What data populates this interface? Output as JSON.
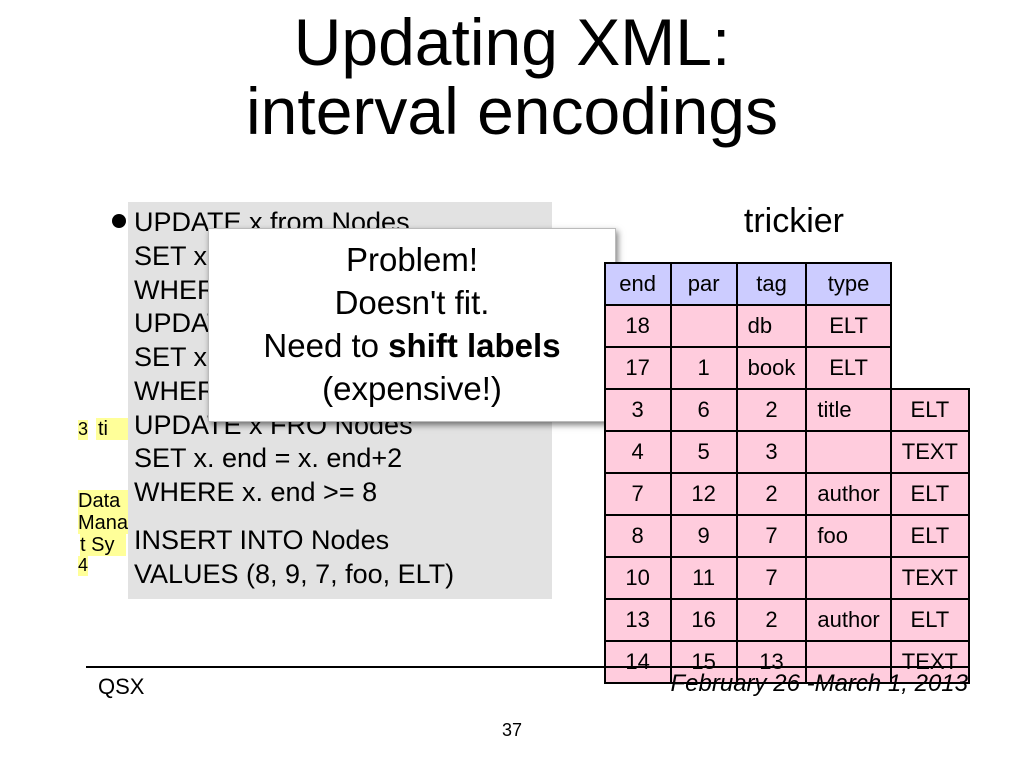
{
  "title_line1": "Updating XML:",
  "title_line2": "interval encodings",
  "trickier_text": "trickier",
  "fragments": {
    "num3": "3",
    "ti": "ti",
    "data": "Data",
    "mana": "Mana",
    "tsy": "t Sy",
    "num4": "4"
  },
  "sql": {
    "l1": "UPDATE x from Nodes",
    "l2": "SET x. begi",
    "l3": "WHERE x.",
    "l4": "UPDATE x",
    "l5": "SET x. par =",
    "l6": "WHERE x.",
    "l7a": "UPDATE x FRO",
    "l7b": " Nodes",
    "l8": "SET x. end = x. end+2",
    "l9": "WHERE x. end >= 8",
    "l10": "INSERT INTO Nodes",
    "l11": "VALUES (8, 9, 7, foo, ELT)"
  },
  "overlay": {
    "l1": "Problem!",
    "l2": "Doesn't fit.",
    "l3a": "Need to ",
    "l3b": "shift labels",
    "l4": "(expensive!)"
  },
  "table": {
    "headers": [
      "end",
      "par",
      "tag",
      "type"
    ],
    "rows": [
      {
        "end": "18",
        "par": "",
        "tag": "db",
        "type": "ELT"
      },
      {
        "end": "17",
        "par": "1",
        "tag": "book",
        "type": "ELT",
        "mid3": "3",
        "mid6": "6",
        "mid2": "2",
        "tagrow": "title",
        "typ": "ELT"
      },
      {
        "c1": "3",
        "c2": "6",
        "c3": "2",
        "tag": "title",
        "type": "ELT"
      },
      {
        "c1": "4",
        "c2": "5",
        "c3": "3",
        "tag": "",
        "type": "TEXT"
      },
      {
        "c1": "7",
        "c2": "12",
        "c3": "2",
        "tag": "author",
        "type": "ELT"
      },
      {
        "c1": "8",
        "c2": "9",
        "c3": "7",
        "tag": "foo",
        "type": "ELT"
      },
      {
        "c1": "10",
        "c2": "11",
        "c3": "7",
        "tag": "",
        "type": "TEXT"
      },
      {
        "c1": "13",
        "c2": "16",
        "c3": "2",
        "tag": "author",
        "type": "ELT"
      },
      {
        "c1": "14",
        "c2": "15",
        "c3": "13",
        "tag": "",
        "type": "TEXT"
      }
    ]
  },
  "footer": {
    "left": "QSX",
    "right": "February 26 -March 1, 2013",
    "page": "37"
  }
}
